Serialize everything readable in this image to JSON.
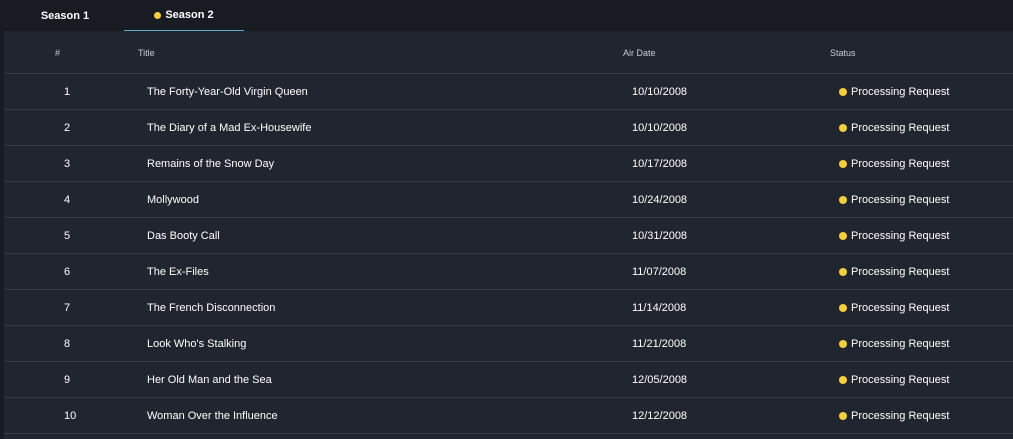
{
  "tabs": [
    {
      "label": "Season 1",
      "active": false
    },
    {
      "label": "Season 2",
      "active": true
    }
  ],
  "colors": {
    "status_dot": "#f5cf3e",
    "active_tab_underline": "#5fa9c9"
  },
  "table": {
    "headers": {
      "num": "#",
      "title": "Title",
      "air_date": "Air Date",
      "status": "Status"
    },
    "rows": [
      {
        "num": "1",
        "title": "The Forty-Year-Old Virgin Queen",
        "air_date": "10/10/2008",
        "status": "Processing Request"
      },
      {
        "num": "2",
        "title": "The Diary of a Mad Ex-Housewife",
        "air_date": "10/10/2008",
        "status": "Processing Request"
      },
      {
        "num": "3",
        "title": "Remains of the Snow Day",
        "air_date": "10/17/2008",
        "status": "Processing Request"
      },
      {
        "num": "4",
        "title": "Mollywood",
        "air_date": "10/24/2008",
        "status": "Processing Request"
      },
      {
        "num": "5",
        "title": "Das Booty Call",
        "air_date": "10/31/2008",
        "status": "Processing Request"
      },
      {
        "num": "6",
        "title": "The Ex-Files",
        "air_date": "11/07/2008",
        "status": "Processing Request"
      },
      {
        "num": "7",
        "title": "The French Disconnection",
        "air_date": "11/14/2008",
        "status": "Processing Request"
      },
      {
        "num": "8",
        "title": "Look Who's Stalking",
        "air_date": "11/21/2008",
        "status": "Processing Request"
      },
      {
        "num": "9",
        "title": "Her Old Man and the Sea",
        "air_date": "12/05/2008",
        "status": "Processing Request"
      },
      {
        "num": "10",
        "title": "Woman Over the Influence",
        "air_date": "12/12/2008",
        "status": "Processing Request"
      }
    ]
  }
}
